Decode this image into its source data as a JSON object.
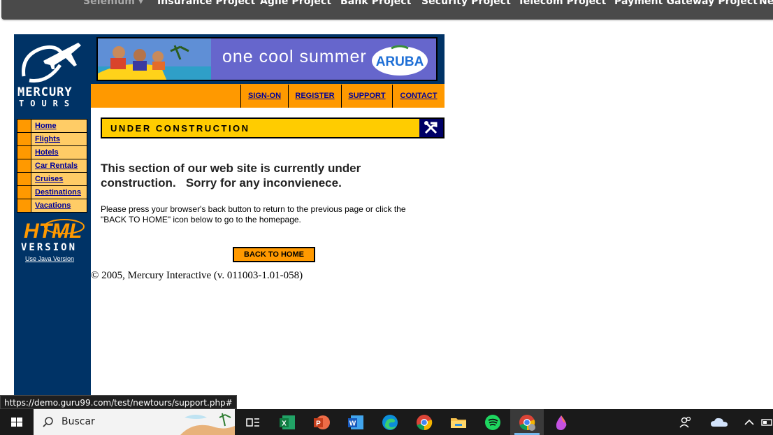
{
  "topnav": {
    "items": [
      {
        "label": "Selenium ▾",
        "dim": true
      },
      {
        "label": "Insurance Project"
      },
      {
        "label": "Agile Project"
      },
      {
        "label": "Bank Project"
      },
      {
        "label": "Security Project"
      },
      {
        "label": "Telecom Project"
      },
      {
        "label": "Payment Gateway Project"
      },
      {
        "label": "Ne"
      }
    ]
  },
  "logo": {
    "line1": "MERCURY",
    "line2": "TOURS"
  },
  "banner": {
    "text": "one cool summer",
    "brand": "ARUBA"
  },
  "top_links": [
    "SIGN-ON",
    "REGISTER",
    "SUPPORT",
    "CONTACT"
  ],
  "sidebar": {
    "items": [
      "Home",
      "Flights",
      "Hotels",
      "Car Rentals",
      "Cruises",
      "Destinations",
      "Vacations"
    ],
    "html_version_line1": "HTML",
    "html_version_line2": "VERSION",
    "java_link": "Use Java Version"
  },
  "content": {
    "header": "UNDER CONSTRUCTION",
    "main_line1": "This section of our web site is currently under",
    "main_line2": "construction.   Sorry for any inconvienece.",
    "sub_line1": "Please press your browser's back button to return to the previous page or click the",
    "sub_line2": "\"BACK TO HOME\" icon below to go to the homepage.",
    "back_button": "BACK TO HOME",
    "copyright": "© 2005, Mercury Interactive (v. 011003-1.01-058)"
  },
  "status_url": "https://demo.guru99.com/test/newtours/support.php#",
  "taskbar": {
    "search_placeholder": "Buscar",
    "icons": [
      "windows-start-icon",
      "search-icon",
      "task-view-icon",
      "excel-icon",
      "powerpoint-icon",
      "word-icon",
      "edge-icon",
      "chrome-icon",
      "file-explorer-icon",
      "spotify-icon",
      "chrome-profile-icon",
      "paint-drop-icon",
      "people-icon",
      "onedrive-icon",
      "chevron-up-icon"
    ]
  },
  "colors": {
    "navy": "#003366",
    "orange": "#ff9900",
    "yellow": "#ffcc00",
    "link": "#000099"
  }
}
